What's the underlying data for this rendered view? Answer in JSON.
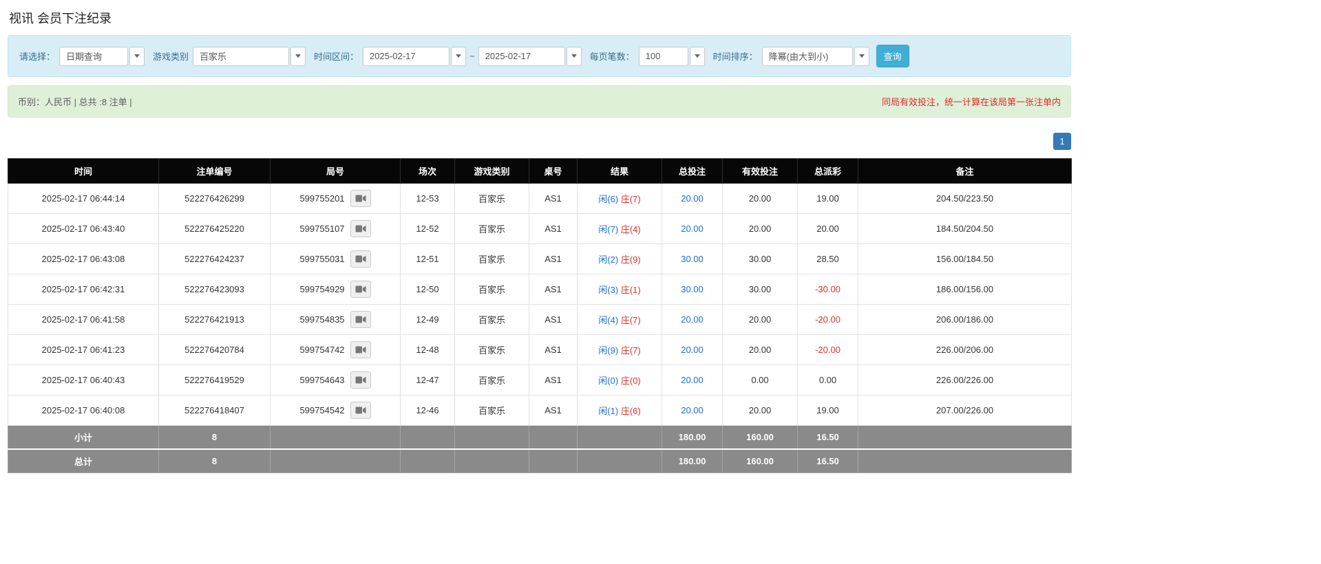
{
  "page": {
    "title": "视讯 会员下注纪录"
  },
  "filters": {
    "query_type_label": "请选择：",
    "query_type_value": "日期查询",
    "game_type_label": "游戏类别",
    "game_type_value": "百家乐",
    "time_range_label": "时间区间：",
    "date_from": "2025-02-17",
    "range_separator": "~",
    "date_to": "2025-02-17",
    "page_size_label": "每页笔数：",
    "page_size_value": "100",
    "sort_label": "时间排序：",
    "sort_value": "降幂(由大到小)",
    "search_button": "查询"
  },
  "summary": {
    "left": "币别：人民币 | 总共 :8 注单 |",
    "note": "同局有效投注，统一计算在该局第一张注单内"
  },
  "pagination": {
    "pages": [
      "1"
    ]
  },
  "table": {
    "headers": [
      "时间",
      "注单编号",
      "局号",
      "场次",
      "游戏类别",
      "桌号",
      "结果",
      "总投注",
      "有效投注",
      "总派彩",
      "备注"
    ],
    "rows": [
      {
        "time": "2025-02-17 06:44:14",
        "bet_id": "522276426299",
        "round_id": "599755201",
        "session": "12-53",
        "game_type": "百家乐",
        "table_no": "AS1",
        "result_player": "闲(6)",
        "result_banker": "庄(7)",
        "total_bet": "20.00",
        "valid_bet": "20.00",
        "payout": "19.00",
        "remark": "204.50/223.50"
      },
      {
        "time": "2025-02-17 06:43:40",
        "bet_id": "522276425220",
        "round_id": "599755107",
        "session": "12-52",
        "game_type": "百家乐",
        "table_no": "AS1",
        "result_player": "闲(7)",
        "result_banker": "庄(4)",
        "total_bet": "20.00",
        "valid_bet": "20.00",
        "payout": "20.00",
        "remark": "184.50/204.50"
      },
      {
        "time": "2025-02-17 06:43:08",
        "bet_id": "522276424237",
        "round_id": "599755031",
        "session": "12-51",
        "game_type": "百家乐",
        "table_no": "AS1",
        "result_player": "闲(2)",
        "result_banker": "庄(9)",
        "total_bet": "30.00",
        "valid_bet": "30.00",
        "payout": "28.50",
        "remark": "156.00/184.50"
      },
      {
        "time": "2025-02-17 06:42:31",
        "bet_id": "522276423093",
        "round_id": "599754929",
        "session": "12-50",
        "game_type": "百家乐",
        "table_no": "AS1",
        "result_player": "闲(3)",
        "result_banker": "庄(1)",
        "total_bet": "30.00",
        "valid_bet": "30.00",
        "payout": "-30.00",
        "remark": "186.00/156.00"
      },
      {
        "time": "2025-02-17 06:41:58",
        "bet_id": "522276421913",
        "round_id": "599754835",
        "session": "12-49",
        "game_type": "百家乐",
        "table_no": "AS1",
        "result_player": "闲(4)",
        "result_banker": "庄(7)",
        "total_bet": "20.00",
        "valid_bet": "20.00",
        "payout": "-20.00",
        "remark": "206.00/186.00"
      },
      {
        "time": "2025-02-17 06:41:23",
        "bet_id": "522276420784",
        "round_id": "599754742",
        "session": "12-48",
        "game_type": "百家乐",
        "table_no": "AS1",
        "result_player": "闲(9)",
        "result_banker": "庄(7)",
        "total_bet": "20.00",
        "valid_bet": "20.00",
        "payout": "-20.00",
        "remark": "226.00/206.00"
      },
      {
        "time": "2025-02-17 06:40:43",
        "bet_id": "522276419529",
        "round_id": "599754643",
        "session": "12-47",
        "game_type": "百家乐",
        "table_no": "AS1",
        "result_player": "闲(0)",
        "result_banker": "庄(0)",
        "total_bet": "20.00",
        "valid_bet": "0.00",
        "payout": "0.00",
        "remark": "226.00/226.00"
      },
      {
        "time": "2025-02-17 06:40:08",
        "bet_id": "522276418407",
        "round_id": "599754542",
        "session": "12-46",
        "game_type": "百家乐",
        "table_no": "AS1",
        "result_player": "闲(1)",
        "result_banker": "庄(6)",
        "total_bet": "20.00",
        "valid_bet": "20.00",
        "payout": "19.00",
        "remark": "207.00/226.00"
      }
    ],
    "footer": [
      {
        "label": "小计",
        "count": "8",
        "total_bet": "180.00",
        "valid_bet": "160.00",
        "payout": "16.50"
      },
      {
        "label": "总计",
        "count": "8",
        "total_bet": "180.00",
        "valid_bet": "160.00",
        "payout": "16.50"
      }
    ]
  },
  "colors": {
    "filter_bar_bg": "#d9edf7",
    "summary_bar_bg": "#dff0d8",
    "search_button_bg": "#41aed6",
    "pagination_active_bg": "#337ab7",
    "table_header_bg": "#070707",
    "table_footer_bg": "#8a8a8a",
    "link_blue": "#1b6fd0",
    "result_player_blue": "#1b6fd0",
    "result_banker_red": "#d9342b",
    "negative_red": "#d9342b",
    "note_red": "#e02a2a"
  }
}
